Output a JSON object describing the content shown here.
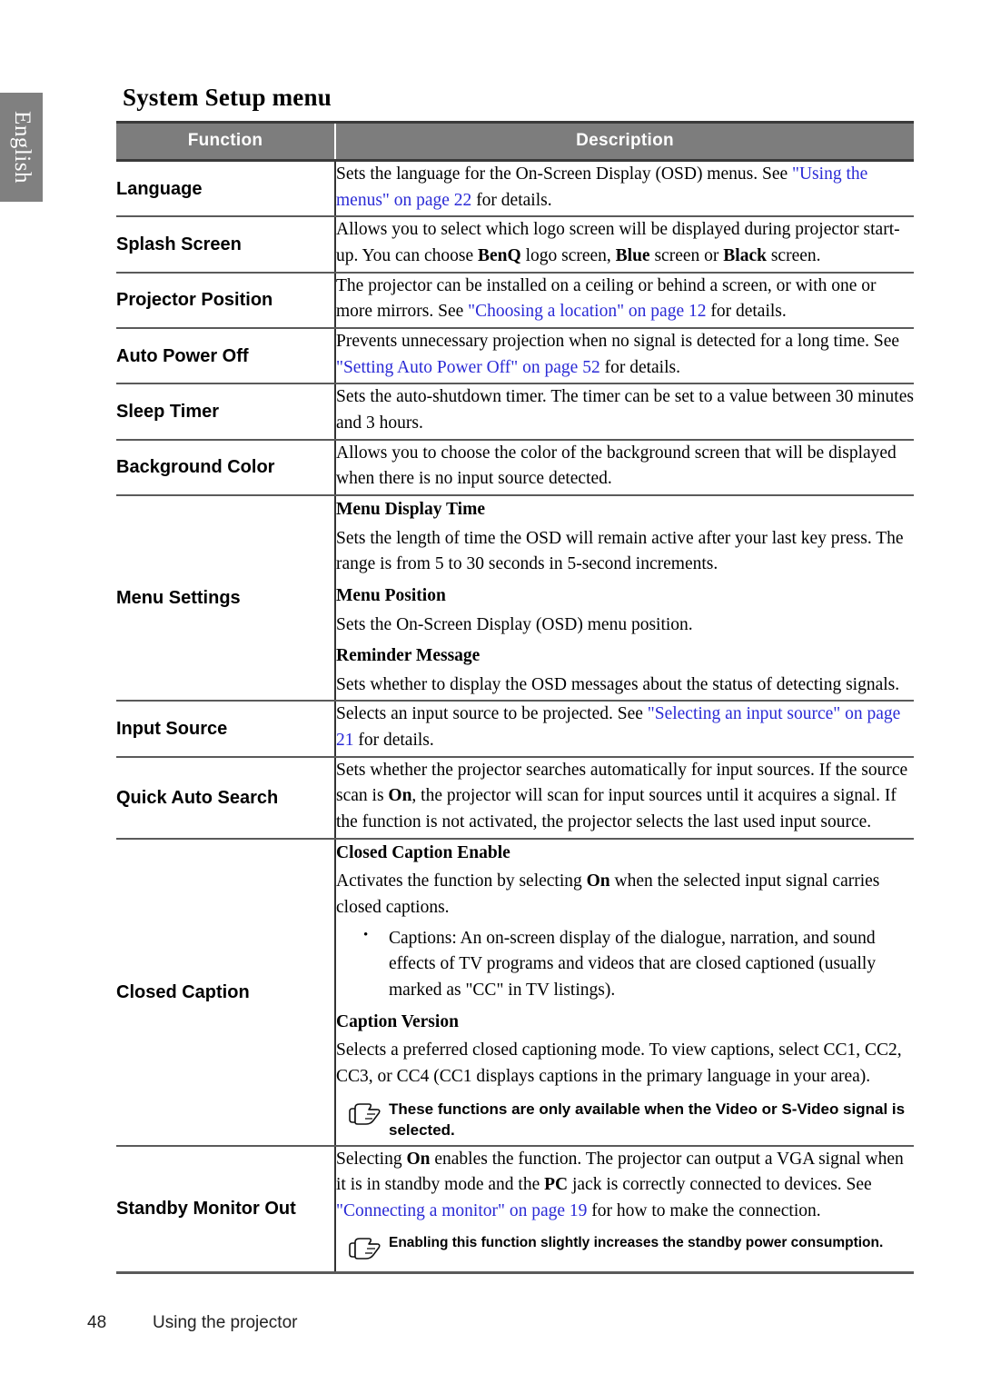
{
  "sidebar": {
    "language_tab": "English"
  },
  "page": {
    "title": "System Setup menu",
    "footer_page_number": "48",
    "footer_section": "Using the projector"
  },
  "colors": {
    "header_bg": "#7d7d7d",
    "header_text": "#ffffff",
    "link": "#2a2ad6",
    "tab_bg": "#808080"
  },
  "table": {
    "columns": {
      "function": "Function",
      "description": "Description"
    },
    "rows": [
      {
        "function": "Language",
        "blocks": [
          {
            "type": "paragraph",
            "parts": [
              {
                "text": "Sets the language for the On-Screen Display (OSD) menus. See ",
                "style": "normal"
              },
              {
                "text": "\"Using the menus\" on page 22",
                "style": "link"
              },
              {
                "text": " for details.",
                "style": "normal"
              }
            ]
          }
        ]
      },
      {
        "function": "Splash Screen",
        "blocks": [
          {
            "type": "paragraph",
            "parts": [
              {
                "text": "Allows you to select which logo screen will be displayed during projector start-up. You can choose ",
                "style": "normal"
              },
              {
                "text": "BenQ",
                "style": "bold"
              },
              {
                "text": " logo screen, ",
                "style": "normal"
              },
              {
                "text": "Blue",
                "style": "bold"
              },
              {
                "text": " screen or ",
                "style": "normal"
              },
              {
                "text": "Black",
                "style": "bold"
              },
              {
                "text": " screen.",
                "style": "normal"
              }
            ]
          }
        ]
      },
      {
        "function": "Projector Position",
        "blocks": [
          {
            "type": "paragraph",
            "parts": [
              {
                "text": "The projector can be installed on a ceiling or behind a screen, or with one or more mirrors. See ",
                "style": "normal"
              },
              {
                "text": "\"Choosing a location\" on page 12",
                "style": "link"
              },
              {
                "text": " for details.",
                "style": "normal"
              }
            ]
          }
        ]
      },
      {
        "function": "Auto Power Off",
        "blocks": [
          {
            "type": "paragraph",
            "parts": [
              {
                "text": "Prevents unnecessary projection when no signal is detected for a long time. See ",
                "style": "normal"
              },
              {
                "text": "\"Setting Auto Power Off\" on page 52",
                "style": "link"
              },
              {
                "text": " for details.",
                "style": "normal"
              }
            ]
          }
        ]
      },
      {
        "function": "Sleep Timer",
        "blocks": [
          {
            "type": "paragraph",
            "parts": [
              {
                "text": "Sets the auto-shutdown timer. The timer can be set to a value between 30 minutes and 3 hours.",
                "style": "normal"
              }
            ]
          }
        ]
      },
      {
        "function": "Background Color",
        "blocks": [
          {
            "type": "paragraph",
            "parts": [
              {
                "text": "Allows you to choose the color of the background screen that will be displayed when there is no input source detected.",
                "style": "normal"
              }
            ]
          }
        ]
      },
      {
        "function": "Menu Settings",
        "blocks": [
          {
            "type": "subhead",
            "text": "Menu Display Time"
          },
          {
            "type": "paragraph",
            "parts": [
              {
                "text": "Sets the length of time the OSD will remain active after your last key press. The range is from 5 to 30 seconds in 5-second increments.",
                "style": "normal"
              }
            ]
          },
          {
            "type": "subhead",
            "text": "Menu Position"
          },
          {
            "type": "paragraph",
            "parts": [
              {
                "text": "Sets the On-Screen Display (OSD) menu position.",
                "style": "normal"
              }
            ]
          },
          {
            "type": "subhead",
            "text": "Reminder Message"
          },
          {
            "type": "paragraph",
            "parts": [
              {
                "text": "Sets whether to display the OSD messages about the status of detecting signals.",
                "style": "normal"
              }
            ]
          }
        ]
      },
      {
        "function": "Input Source",
        "blocks": [
          {
            "type": "paragraph",
            "parts": [
              {
                "text": "Selects an input source to be projected. See ",
                "style": "normal"
              },
              {
                "text": "\"Selecting an input source\" on page 21",
                "style": "link"
              },
              {
                "text": " for details.",
                "style": "normal"
              }
            ]
          }
        ]
      },
      {
        "function": "Quick Auto Search",
        "blocks": [
          {
            "type": "paragraph",
            "parts": [
              {
                "text": "Sets whether the projector searches automatically for input sources. If the source scan is ",
                "style": "normal"
              },
              {
                "text": "On",
                "style": "bold"
              },
              {
                "text": ", the projector will scan for input sources until it acquires a signal. If the function is not activated, the projector selects the last used input source.",
                "style": "normal"
              }
            ]
          }
        ]
      },
      {
        "function": "Closed Caption",
        "blocks": [
          {
            "type": "subhead",
            "text": "Closed Caption Enable"
          },
          {
            "type": "paragraph",
            "parts": [
              {
                "text": "Activates the function by selecting ",
                "style": "normal"
              },
              {
                "text": "On",
                "style": "bold"
              },
              {
                "text": " when the selected input signal carries closed captions.",
                "style": "normal"
              }
            ]
          },
          {
            "type": "bullets",
            "items": [
              "Captions: An on-screen display of the dialogue, narration, and sound effects of TV programs and videos that are closed captioned (usually marked as \"CC\" in TV listings)."
            ]
          },
          {
            "type": "subhead",
            "text": "Caption Version"
          },
          {
            "type": "paragraph",
            "parts": [
              {
                "text": "Selects a preferred closed captioning mode. To view captions, select CC1, CC2, CC3, or CC4 (CC1 displays captions in the primary language in your area).",
                "style": "normal"
              }
            ]
          },
          {
            "type": "note",
            "icon": "pointing-hand-icon",
            "text": "These functions are only available when the Video or S-Video signal is selected."
          }
        ]
      },
      {
        "function": "Standby Monitor Out",
        "blocks": [
          {
            "type": "paragraph",
            "parts": [
              {
                "text": "Selecting ",
                "style": "normal"
              },
              {
                "text": "On",
                "style": "bold"
              },
              {
                "text": " enables the function. The projector can output a VGA signal when it is in standby mode and the ",
                "style": "normal"
              },
              {
                "text": "PC",
                "style": "bold"
              },
              {
                "text": " jack is correctly connected to devices. See ",
                "style": "normal"
              },
              {
                "text": "\"Connecting a monitor\" on page 19",
                "style": "link"
              },
              {
                "text": " for how to make the connection.",
                "style": "normal"
              }
            ]
          },
          {
            "type": "note",
            "icon": "pointing-hand-icon",
            "small": true,
            "text": "Enabling this function slightly increases the standby power consumption."
          }
        ]
      }
    ]
  }
}
